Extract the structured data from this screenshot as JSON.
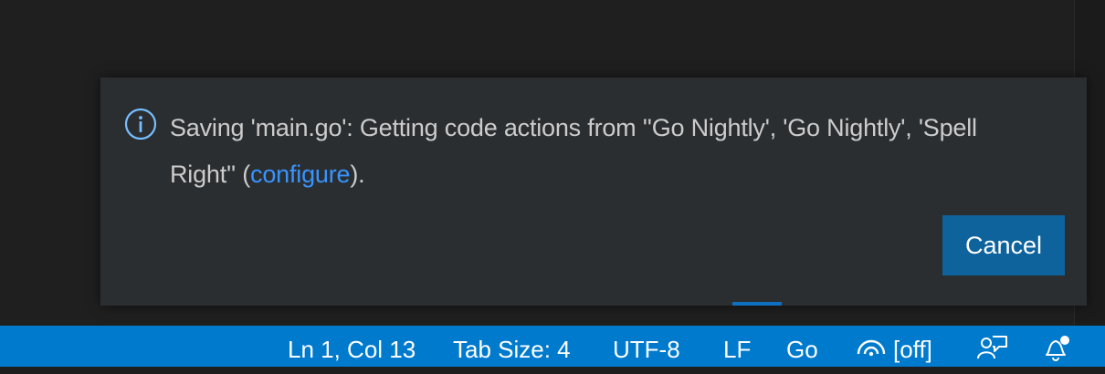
{
  "notification": {
    "message_before_link": "Saving 'main.go': Getting code actions from ''Go Nightly', 'Go Nightly', 'Spell Right'' (",
    "link_label": "configure",
    "message_after_link": ").",
    "cancel_label": "Cancel",
    "icon": "info-icon"
  },
  "statusbar": {
    "cursor_position": "Ln 1, Col 13",
    "tab_size": "Tab Size: 4",
    "encoding": "UTF-8",
    "line_ending": "LF",
    "language": "Go",
    "live_share_status": "[off]",
    "icons": [
      "broadcast-icon",
      "feedback-icon",
      "notifications-bell-icon"
    ],
    "background_color": "#007acc"
  },
  "colors": {
    "editor_background": "#1f1f1f",
    "toast_background": "#2b2e31",
    "toast_text": "#cccccc",
    "link": "#3794ff",
    "button": "#0e639c"
  }
}
